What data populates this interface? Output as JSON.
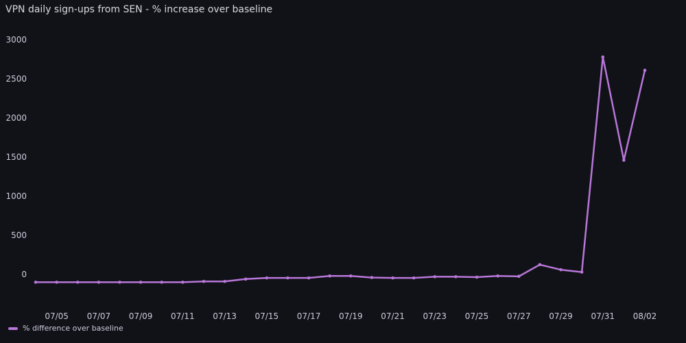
{
  "panel": {
    "title": "VPN daily sign-ups from SEN - % increase over baseline"
  },
  "colors": {
    "background": "#111217",
    "series": "#b877d9",
    "grid": "#26272d",
    "tick_text": "#ccccdc"
  },
  "chart_data": {
    "type": "line",
    "title": "VPN daily sign-ups from SEN - % increase over baseline",
    "xlabel": "",
    "ylabel": "",
    "ylim": [
      -200,
      3000
    ],
    "yticks": [
      0,
      500,
      1000,
      1500,
      2000,
      2500,
      3000
    ],
    "x": [
      "07/04",
      "07/05",
      "07/06",
      "07/07",
      "07/08",
      "07/09",
      "07/10",
      "07/11",
      "07/12",
      "07/13",
      "07/14",
      "07/15",
      "07/16",
      "07/17",
      "07/18",
      "07/19",
      "07/20",
      "07/21",
      "07/22",
      "07/23",
      "07/24",
      "07/25",
      "07/26",
      "07/27",
      "07/28",
      "07/29",
      "07/30",
      "07/31",
      "08/01",
      "08/02"
    ],
    "xticks": [
      "07/05",
      "07/07",
      "07/09",
      "07/11",
      "07/13",
      "07/15",
      "07/17",
      "07/19",
      "07/21",
      "07/23",
      "07/25",
      "07/27",
      "07/29",
      "07/31",
      "08/02"
    ],
    "grid": false,
    "legend_placement": "bottom-left",
    "series": [
      {
        "name": "% difference over baseline",
        "values": [
          -100,
          -100,
          -100,
          -100,
          -100,
          -100,
          -100,
          -100,
          -90,
          -90,
          -60,
          -45,
          -45,
          -45,
          -20,
          -20,
          -40,
          -45,
          -45,
          -30,
          -30,
          -35,
          -20,
          -25,
          125,
          60,
          30,
          2780,
          1460,
          2610
        ]
      }
    ]
  }
}
